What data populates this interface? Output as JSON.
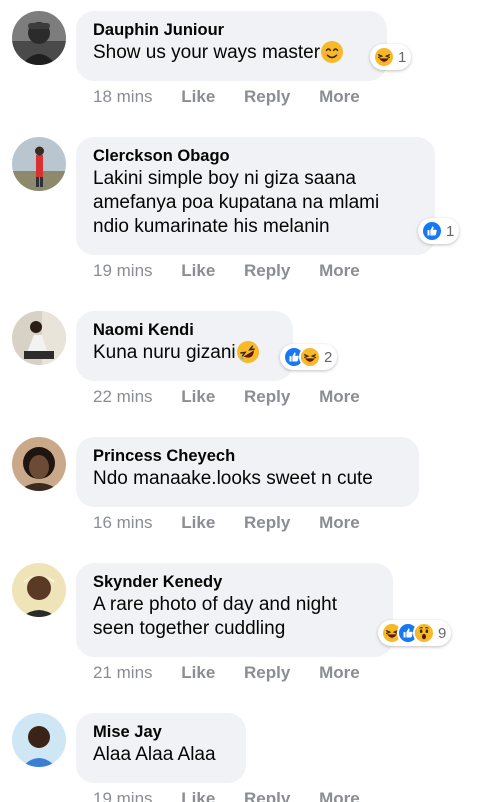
{
  "actions": {
    "like": "Like",
    "reply": "Reply",
    "more": "More"
  },
  "comments": [
    {
      "author": "Dauphin Juniour",
      "text": "Show us your ways master",
      "time": "18 mins",
      "reaction_count": "1"
    },
    {
      "author": "Clerckson Obago",
      "text": "Lakini simple boy ni giza saana\namefanya poa kupatana na mlami\nndio kumarinate his melanin",
      "time": "19 mins",
      "reaction_count": "1"
    },
    {
      "author": "Naomi Kendi",
      "text": "Kuna nuru gizani",
      "time": "22 mins",
      "reaction_count": "2"
    },
    {
      "author": "Princess Cheyech",
      "text": "Ndo manaake.looks sweet n cute",
      "time": "16 mins"
    },
    {
      "author": "Skynder Kenedy",
      "text": "A rare photo of day and night\nseen together cuddling",
      "time": "21 mins",
      "reaction_count": "9"
    },
    {
      "author": "Mise Jay",
      "text": "Alaa Alaa Alaa",
      "time": "19 mins"
    }
  ],
  "colors": {
    "bubble": "#f0f2f5",
    "meta": "#8a8d91",
    "like_blue": "#1877f2",
    "haha_yellow": "#f7b928"
  },
  "icons": {
    "like": "like-reaction-icon",
    "haha": "haha-reaction-icon",
    "wow": "wow-reaction-icon",
    "smile": "smile-emoji-icon",
    "laugh": "rofl-emoji-icon"
  }
}
